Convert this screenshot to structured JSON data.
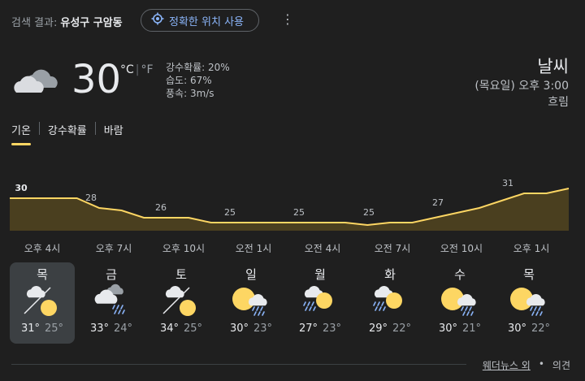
{
  "search": {
    "prefix": "검색 결과:",
    "location": "유성구 구암동"
  },
  "location_button": {
    "label": "정확한 위치 사용"
  },
  "current": {
    "temperature": "30",
    "unit_c": "°C",
    "unit_sep": "|",
    "unit_f": "°F",
    "precip": "강수확률: 20%",
    "humidity": "습도: 67%",
    "wind": "풍속: 3m/s",
    "icon": "cloudy-icon"
  },
  "header": {
    "title": "날씨",
    "datetime": "(목요일) 오후 3:00",
    "condition": "흐림"
  },
  "tabs": [
    {
      "label": "기온",
      "active": true
    },
    {
      "label": "강수확률",
      "active": false
    },
    {
      "label": "바람",
      "active": false
    }
  ],
  "hours": [
    "오후 4시",
    "오후 7시",
    "오후 10시",
    "오전 1시",
    "오전 4시",
    "오전 7시",
    "오전 10시",
    "오후 1시"
  ],
  "chart_data": {
    "type": "area",
    "x": [
      "오후 4시",
      "오후 7시",
      "오후 10시",
      "오전 1시",
      "오전 4시",
      "오전 7시",
      "오전 10시",
      "오후 1시"
    ],
    "values": [
      30,
      28,
      26,
      25,
      25,
      25,
      27,
      31
    ],
    "color": "#fdd663"
  },
  "days": [
    {
      "name": "목",
      "hi": "31°",
      "lo": "25°",
      "icon": "partly-sunny-icon",
      "selected": true
    },
    {
      "name": "금",
      "hi": "33°",
      "lo": "24°",
      "icon": "cloud-rain-icon",
      "selected": false
    },
    {
      "name": "토",
      "hi": "34°",
      "lo": "25°",
      "icon": "partly-sunny-icon",
      "selected": false
    },
    {
      "name": "일",
      "hi": "30°",
      "lo": "23°",
      "icon": "sun-rain-icon",
      "selected": false
    },
    {
      "name": "월",
      "hi": "27°",
      "lo": "23°",
      "icon": "rain-sun-icon",
      "selected": false
    },
    {
      "name": "화",
      "hi": "29°",
      "lo": "22°",
      "icon": "rain-sun-icon",
      "selected": false
    },
    {
      "name": "수",
      "hi": "30°",
      "lo": "21°",
      "icon": "sun-rain-icon",
      "selected": false
    },
    {
      "name": "목",
      "hi": "30°",
      "lo": "22°",
      "icon": "sun-rain-icon",
      "selected": false
    }
  ],
  "footer": {
    "source": "웨더뉴스 외",
    "dot": "•",
    "feedback": "의견"
  }
}
